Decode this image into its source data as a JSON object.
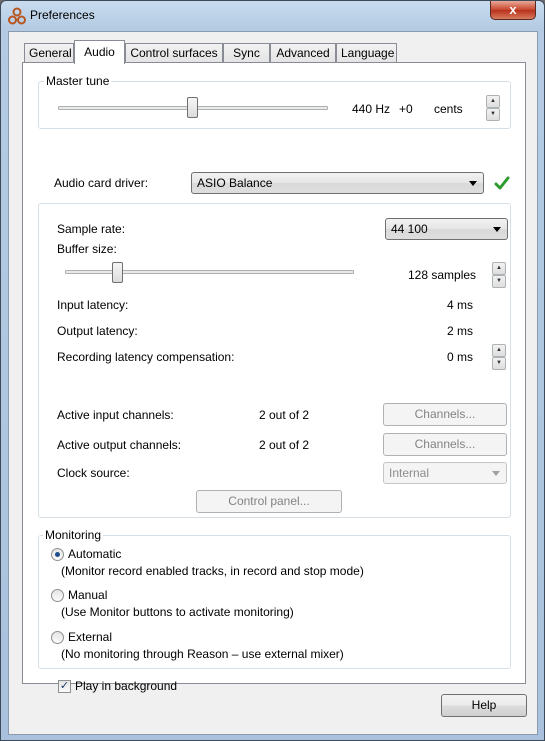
{
  "window": {
    "title": "Preferences",
    "close_glyph": "x"
  },
  "tabs": [
    {
      "label": "General"
    },
    {
      "label": "Audio",
      "active": true
    },
    {
      "label": "Control surfaces"
    },
    {
      "label": "Sync"
    },
    {
      "label": "Advanced"
    },
    {
      "label": "Language"
    }
  ],
  "master_tune": {
    "group_label": "Master tune",
    "hz": "440 Hz",
    "offset": "+0",
    "unit": "cents",
    "slider_position": 0.5
  },
  "audio_card": {
    "label": "Audio card driver:",
    "value": "ASIO Balance",
    "status_icon": "green-checkmark",
    "status_color": "#2e9b2e"
  },
  "settings": {
    "sample_rate_label": "Sample rate:",
    "sample_rate_value": "44 100",
    "buffer_size_label": "Buffer size:",
    "buffer_size_value": "128 samples",
    "buffer_slider_position": 0.18,
    "input_latency_label": "Input latency:",
    "input_latency_value": "4 ms",
    "output_latency_label": "Output latency:",
    "output_latency_value": "2 ms",
    "recording_comp_label": "Recording latency compensation:",
    "recording_comp_value": "0 ms",
    "active_input_label": "Active input channels:",
    "active_input_value": "2 out of 2",
    "active_output_label": "Active output channels:",
    "active_output_value": "2 out of 2",
    "channels_button": "Channels...",
    "clock_source_label": "Clock source:",
    "clock_source_value": "Internal",
    "control_panel_button": "Control panel..."
  },
  "monitoring": {
    "group_label": "Monitoring",
    "options": [
      {
        "label": "Automatic",
        "desc": "(Monitor record enabled tracks, in record and stop mode)",
        "checked": true
      },
      {
        "label": "Manual",
        "desc": "(Use Monitor buttons to activate monitoring)",
        "checked": false
      },
      {
        "label": "External",
        "desc": "(No monitoring through Reason – use external mixer)",
        "checked": false
      }
    ]
  },
  "play_in_background": {
    "label": "Play in background",
    "checked": true
  },
  "help_button": "Help"
}
